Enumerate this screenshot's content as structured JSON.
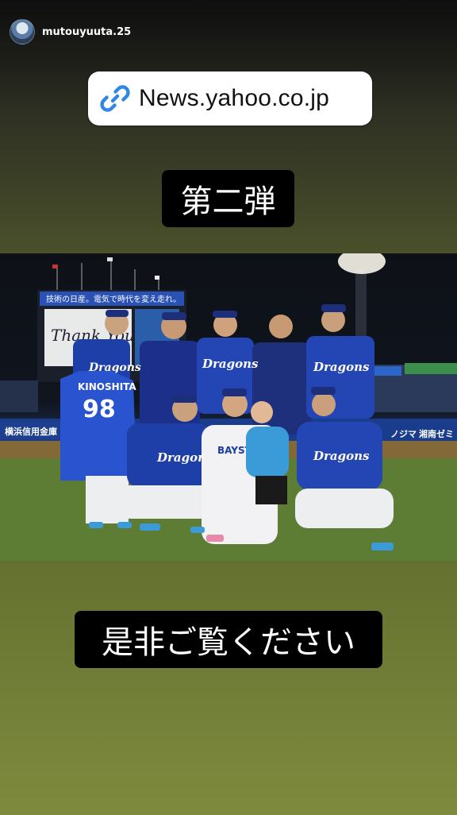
{
  "story": {
    "username": "mutouyuuta.25",
    "link_sticker": {
      "text": "News.yahoo.co.jp",
      "icon": "link-icon"
    },
    "caption_top": "第二弾",
    "caption_bottom": "是非ご覧ください"
  },
  "photo": {
    "scoreboard_banner": "技術の日産。電気で時代を変え走れ。",
    "scoreboard_message": "Thank You",
    "jersey_name": "KINOSHITA",
    "jersey_number": "98",
    "team_wordmark": "Dragons",
    "opponent_wordmark": "BAYSTARS",
    "ad_left": "横浜信用金庫",
    "ad_right_1": "ノジマ",
    "ad_right_2": "湘南ゼミ",
    "colors": {
      "team_blue": "#1f3fa8",
      "field_green": "#5f7d33",
      "night_sky": "#0d1117"
    }
  }
}
